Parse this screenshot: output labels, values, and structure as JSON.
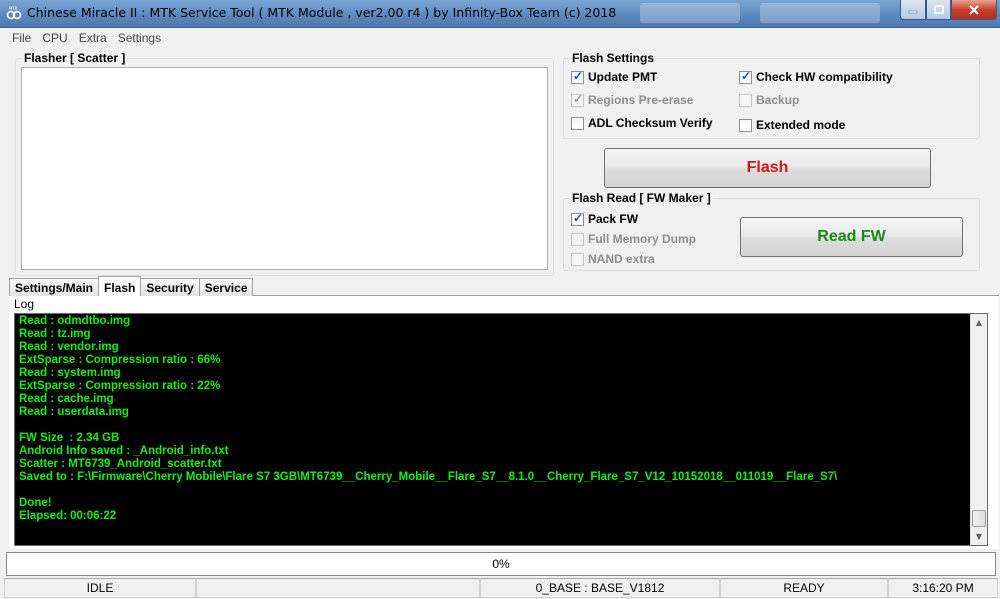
{
  "window": {
    "title": "Chinese Miracle II : MTK Service Tool ( MTK Module , ver2.00 r4  ) by Infinity-Box Team (c) 2018"
  },
  "menu": [
    "File",
    "CPU",
    "Extra",
    "Settings"
  ],
  "flasher": {
    "group_title": "Flasher [ Scatter ]"
  },
  "flash_settings": {
    "group_title": "Flash Settings",
    "update_pmt": {
      "label": "Update PMT",
      "checked": true,
      "enabled": true
    },
    "check_hw": {
      "label": "Check HW compatibility",
      "checked": true,
      "enabled": true
    },
    "regions_preerase": {
      "label": "Regions Pre-erase",
      "checked": true,
      "enabled": false
    },
    "backup": {
      "label": "Backup",
      "checked": false,
      "enabled": false
    },
    "adl_checksum": {
      "label": "ADL Checksum Verify",
      "checked": false,
      "enabled": true
    },
    "extended_mode": {
      "label": "Extended mode",
      "checked": false,
      "enabled": true
    },
    "flash_button": "Flash"
  },
  "flash_read": {
    "group_title": "Flash Read [ FW Maker ]",
    "pack_fw": {
      "label": "Pack FW",
      "checked": true,
      "enabled": true
    },
    "full_memory_dump": {
      "label": "Full Memory Dump",
      "checked": false,
      "enabled": false
    },
    "nand_extra": {
      "label": "NAND extra",
      "checked": false,
      "enabled": false
    },
    "read_fw_button": "Read FW"
  },
  "tabs": [
    "Settings/Main",
    "Flash",
    "Security",
    "Service"
  ],
  "active_tab": "Flash",
  "log": {
    "label": "Log",
    "lines": [
      "Read : odmdtbo.img",
      "Read : tz.img",
      "Read : vendor.img",
      "ExtSparse : Compression ratio : 66%",
      "Read : system.img",
      "ExtSparse : Compression ratio : 22%",
      "Read : cache.img",
      "Read : userdata.img",
      "",
      "FW Size  : 2.34 GB",
      "Android Info saved : _Android_info.txt",
      "Scatter : MT6739_Android_scatter.txt",
      "Saved to : F:\\Firmware\\Cherry Mobile\\Flare S7 3GB\\MT6739__Cherry_Mobile__Flare_S7__8.1.0__Cherry_Flare_S7_V12_10152018__011019__Flare_S7\\",
      "",
      "Done!",
      "Elapsed: 00:06:22"
    ]
  },
  "progress": {
    "text": "0%",
    "fraction": 0.0
  },
  "status": {
    "state": "IDLE",
    "base": "0_BASE : BASE_V1812",
    "ready": "READY",
    "time": "3:16:20 PM"
  },
  "colors": {
    "flash_button_text": "#e01010",
    "read_fw_button_text": "#168a16",
    "log_text": "#12f012",
    "log_background": "#000000"
  }
}
